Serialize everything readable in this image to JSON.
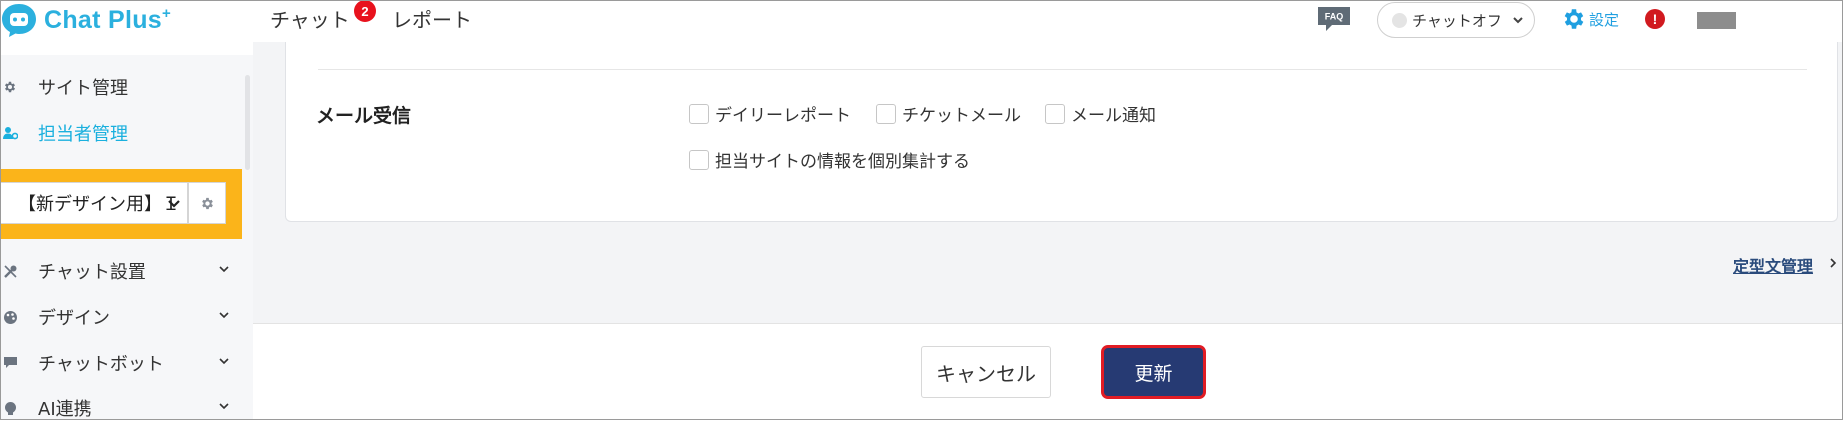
{
  "app": {
    "logo_text": "Chat Plus",
    "logo_sup": "+"
  },
  "header": {
    "nav": [
      {
        "label": "チャット",
        "badge": "2"
      },
      {
        "label": "レポート"
      }
    ],
    "faq_label": "FAQ",
    "status_label": "チャットオフ",
    "settings_label": "設定",
    "alert_label": "!"
  },
  "sidebar": {
    "items": [
      {
        "label": "サイト管理",
        "icon": "gear-icon"
      },
      {
        "label": "担当者管理",
        "icon": "user-gear-icon",
        "active": true
      }
    ],
    "site_select_value": "【新デザイン用】Ｉ",
    "menu": [
      {
        "label": "チャット設置",
        "icon": "tools-icon"
      },
      {
        "label": "デザイン",
        "icon": "palette-icon"
      },
      {
        "label": "チャットボット",
        "icon": "chat-icon"
      },
      {
        "label": "AI連携",
        "icon": "ai-icon"
      }
    ]
  },
  "main": {
    "mail_section": {
      "label": "メール受信",
      "options": [
        {
          "label": "デイリーレポート",
          "checked": false
        },
        {
          "label": "チケットメール",
          "checked": false
        },
        {
          "label": "メール通知",
          "checked": false
        },
        {
          "label": "担当サイトの情報を個別集計する",
          "checked": false
        }
      ]
    },
    "template_link": "定型文管理",
    "cancel_label": "キャンセル",
    "update_label": "更新"
  },
  "colors": {
    "brand": "#2bb0de",
    "active": "#1ab0de",
    "highlight": "#fbb41a",
    "primary_button": "#263a73",
    "alert": "#e11c24"
  }
}
